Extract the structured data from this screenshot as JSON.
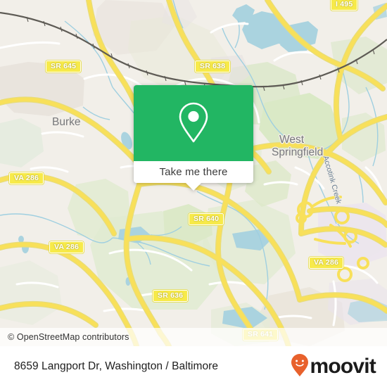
{
  "map": {
    "attribution": "© OpenStreetMap contributors",
    "places": [
      {
        "name": "Burke"
      },
      {
        "name": "West"
      },
      {
        "name": "Springfield"
      }
    ],
    "water_labels": [
      {
        "name": "Accotink Creek"
      }
    ],
    "road_shields": [
      {
        "label": "I 495"
      },
      {
        "label": "SR 645"
      },
      {
        "label": "SR 638"
      },
      {
        "label": "VA 286"
      },
      {
        "label": "SR 640"
      },
      {
        "label": "VA 286"
      },
      {
        "label": "VA 286"
      },
      {
        "label": "SR 636"
      },
      {
        "label": "SR 641"
      }
    ],
    "colors": {
      "land": "#f2efe9",
      "green_area": "#d7e8c4",
      "water": "#aad3df",
      "road_major": "#f8e05a",
      "road_minor": "#ffffff",
      "residential": "#e8e0e8",
      "railway": "#706f6c",
      "shield_fill": "#f7ea4a",
      "label_text": "#77787b"
    }
  },
  "callout": {
    "icon": "map-pin-icon",
    "cta_label": "Take me there",
    "accent_color": "#22b663"
  },
  "footer": {
    "title": "8659 Langport Dr, Washington / Baltimore",
    "brand": "moovit",
    "brand_color": "#e8612c"
  }
}
